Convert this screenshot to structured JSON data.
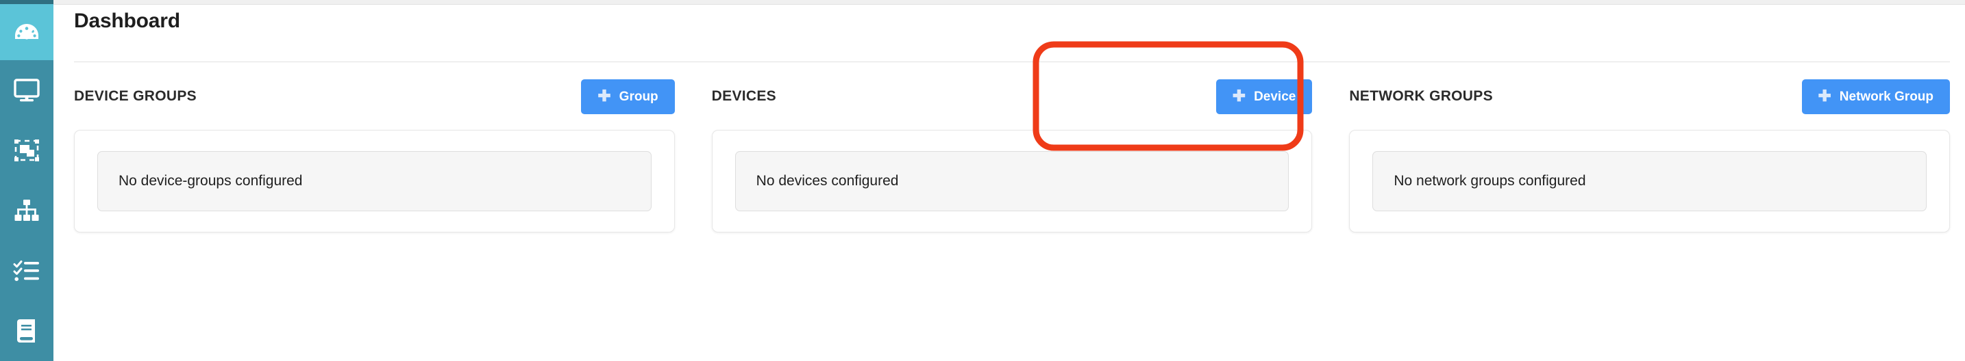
{
  "sidebar": {
    "background_color": "#3e8ea4",
    "active_color": "#5bc4d8",
    "items": [
      {
        "name": "dashboard",
        "icon": "speedometer-icon",
        "active": true
      },
      {
        "name": "devices",
        "icon": "monitor-icon",
        "active": false
      },
      {
        "name": "device-groups",
        "icon": "layers-icon",
        "active": false
      },
      {
        "name": "network-groups",
        "icon": "sitemap-icon",
        "active": false
      },
      {
        "name": "tasks",
        "icon": "checklist-icon",
        "active": false
      },
      {
        "name": "docs",
        "icon": "book-icon",
        "active": false
      }
    ]
  },
  "header": {
    "title": "Dashboard"
  },
  "columns": [
    {
      "title": "DEVICE GROUPS",
      "button": {
        "label": "Group",
        "icon": "plus-icon",
        "color": "#4294f6"
      },
      "empty_message": "No device-groups configured"
    },
    {
      "title": "DEVICES",
      "button": {
        "label": "Device",
        "icon": "plus-icon",
        "color": "#4294f6"
      },
      "empty_message": "No devices configured"
    },
    {
      "title": "NETWORK GROUPS",
      "button": {
        "label": "Network Group",
        "icon": "plus-icon",
        "color": "#4294f6"
      },
      "empty_message": "No network groups configured"
    }
  ],
  "annotation": {
    "shape": "rounded-rectangle",
    "color": "#ef3b18",
    "target": "Device button"
  }
}
